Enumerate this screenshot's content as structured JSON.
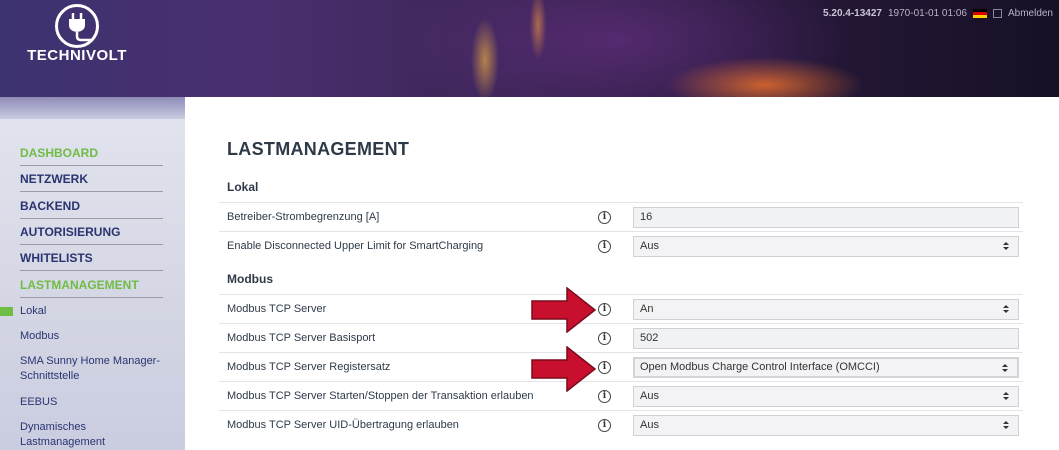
{
  "header": {
    "logo_text": "TECHNIVOLT",
    "version": "5.20.4-13427",
    "datetime": "1970-01-01 01:06",
    "logout": "Abmelden",
    "flag_colors": [
      "#000000",
      "#dd0000",
      "#ffce00"
    ]
  },
  "sidebar": {
    "items": [
      {
        "label": "DASHBOARD",
        "active": true
      },
      {
        "label": "NETZWERK"
      },
      {
        "label": "BACKEND"
      },
      {
        "label": "AUTORISIERUNG"
      },
      {
        "label": "WHITELISTS"
      },
      {
        "label": "LASTMANAGEMENT",
        "active": true
      }
    ],
    "subitems": [
      {
        "label": "Lokal",
        "active": true
      },
      {
        "label": "Modbus"
      },
      {
        "label": "SMA Sunny Home Manager-Schnittstelle"
      },
      {
        "label": "EEBUS"
      },
      {
        "label": "Dynamisches Lastmanagement"
      }
    ],
    "accent_color": "#6fbd45"
  },
  "main": {
    "title": "LASTMANAGEMENT",
    "sections": [
      {
        "title": "Lokal",
        "rows": [
          {
            "label": "Betreiber-Strombegrenzung [A]",
            "value": "16",
            "type": "input"
          },
          {
            "label": "Enable Disconnected Upper Limit for SmartCharging",
            "value": "Aus",
            "type": "select"
          }
        ]
      },
      {
        "title": "Modbus",
        "rows": [
          {
            "label": "Modbus TCP Server",
            "value": "An",
            "type": "select"
          },
          {
            "label": "Modbus TCP Server Basisport",
            "value": "502",
            "type": "input"
          },
          {
            "label": "Modbus TCP Server Registersatz",
            "value": "Open Modbus Charge Control Interface (OMCCI)",
            "type": "select"
          },
          {
            "label": "Modbus TCP Server Starten/Stoppen der Transaktion erlauben",
            "value": "Aus",
            "type": "select"
          },
          {
            "label": "Modbus TCP Server UID-Übertragung erlauben",
            "value": "Aus",
            "type": "select"
          }
        ]
      }
    ],
    "info_icon": "info-icon",
    "annotation_arrow_color": "#c8102e"
  }
}
